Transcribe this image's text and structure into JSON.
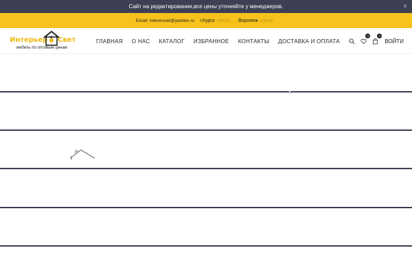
{
  "notice": {
    "text": "Сайт на редактировании,все цены уточняйте у менеджеров.",
    "close": "x"
  },
  "contacts": {
    "email": "Email: interersvet@yandex.ru",
    "city1": "г.Курск",
    "city1_phone": "+7(4712)…",
    "city2": "Воронеж",
    "city2_phone": "+7(473)2…"
  },
  "logo": {
    "word_left": "Интерьер",
    "word_right": "Свет",
    "tagline": "мебель по оптовым ценам"
  },
  "nav": {
    "items": [
      "ГЛАВНАЯ",
      "О НАС",
      "КАТАЛОГ",
      "ИЗБРАННОЕ",
      "КОНТАКТЫ",
      "ДОСТАВКА И ОПЛАТА"
    ]
  },
  "tools": {
    "wishlist_count": "0",
    "cart_count": "0",
    "login": "ВОЙТИ"
  },
  "colors": {
    "accent": "#f7c21b",
    "dark": "#3d3f52"
  }
}
